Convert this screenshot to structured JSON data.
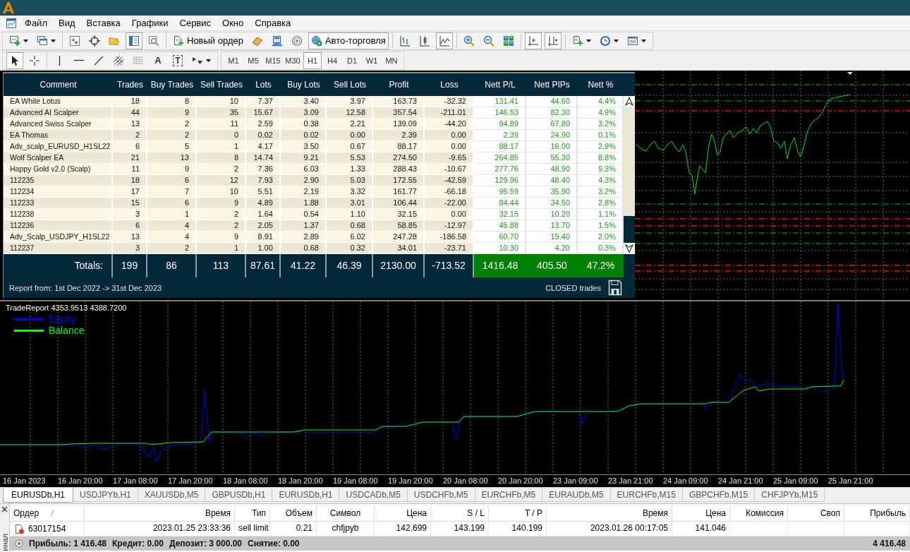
{
  "menu": [
    "Файл",
    "Вид",
    "Вставка",
    "Графики",
    "Сервис",
    "Окно",
    "Справка"
  ],
  "toolbar": [
    [
      {
        "kind": "newchart",
        "dropdown": true,
        "pressed": false
      },
      {
        "kind": "profiles",
        "dropdown": true,
        "pressed": false
      }
    ],
    [
      {
        "kind": "marketwatch",
        "dropdown": false,
        "pressed": false
      },
      {
        "kind": "navigator",
        "dropdown": false,
        "pressed": false
      },
      {
        "kind": "favorites",
        "dropdown": false,
        "pressed": false
      },
      {
        "kind": "datawindow",
        "dropdown": false,
        "pressed": true
      },
      {
        "kind": "tester",
        "dropdown": false,
        "pressed": false
      }
    ],
    [
      {
        "kind": "order",
        "label": "Новый ордер",
        "dropdown": false,
        "pressed": false
      },
      {
        "kind": "editor",
        "dropdown": false,
        "pressed": false
      },
      {
        "kind": "terminal",
        "dropdown": false,
        "pressed": false
      },
      {
        "kind": "signals",
        "dropdown": false,
        "pressed": false
      },
      {
        "kind": "autotrade",
        "label": "Авто-торговля",
        "dropdown": false,
        "pressed": true
      }
    ],
    [
      {
        "kind": "bars",
        "dropdown": false,
        "pressed": false
      },
      {
        "kind": "candles",
        "dropdown": false,
        "pressed": false
      },
      {
        "kind": "linechart",
        "dropdown": false,
        "pressed": true
      }
    ],
    [
      {
        "kind": "zoomin",
        "dropdown": false,
        "pressed": false
      },
      {
        "kind": "zoomout",
        "dropdown": false,
        "pressed": false
      },
      {
        "kind": "tile",
        "dropdown": false,
        "pressed": false
      }
    ],
    [
      {
        "kind": "autoscroll",
        "dropdown": false,
        "pressed": true
      },
      {
        "kind": "shift",
        "dropdown": false,
        "pressed": true
      }
    ],
    [
      {
        "kind": "indicators",
        "dropdown": true,
        "pressed": false
      },
      {
        "kind": "periods",
        "dropdown": true,
        "pressed": false
      },
      {
        "kind": "templates",
        "dropdown": true,
        "pressed": false
      }
    ]
  ],
  "tools": [
    [
      {
        "kind": "cursor",
        "dropdown": false,
        "pressed": true
      },
      {
        "kind": "crosshair",
        "dropdown": false,
        "pressed": false
      }
    ],
    [
      {
        "kind": "vline",
        "dropdown": false,
        "pressed": false
      },
      {
        "kind": "hline",
        "dropdown": false,
        "pressed": false
      },
      {
        "kind": "trendline",
        "dropdown": false,
        "pressed": false
      },
      {
        "kind": "fibochannel",
        "dropdown": false,
        "pressed": false
      },
      {
        "kind": "fibolines",
        "dropdown": false,
        "pressed": false
      },
      {
        "kind": "text",
        "glyph": "A",
        "dropdown": false,
        "pressed": false
      },
      {
        "kind": "label",
        "glyph": "T",
        "dropdown": false,
        "pressed": false
      },
      {
        "kind": "arrows",
        "dropdown": true,
        "pressed": false
      }
    ]
  ],
  "timeframes": [
    {
      "label": "M1",
      "selected": false
    },
    {
      "label": "M5",
      "selected": false
    },
    {
      "label": "M15",
      "selected": false
    },
    {
      "label": "M30",
      "selected": false
    },
    {
      "label": "H1",
      "selected": true
    },
    {
      "label": "H4",
      "selected": false
    },
    {
      "label": "D1",
      "selected": false
    },
    {
      "label": "W1",
      "selected": false
    },
    {
      "label": "MN",
      "selected": false
    }
  ],
  "report": {
    "columns": [
      {
        "label": "Comment",
        "kind": "name"
      },
      {
        "label": "Trades",
        "kind": "value"
      },
      {
        "label": "Buy Trades",
        "kind": "value"
      },
      {
        "label": "Sell Trades",
        "kind": "value"
      },
      {
        "label": "Lots",
        "kind": "value"
      },
      {
        "label": "Buy Lots",
        "kind": "value"
      },
      {
        "label": "Sell Lots",
        "kind": "value"
      },
      {
        "label": "Profit",
        "kind": "value"
      },
      {
        "label": "Loss",
        "kind": "value"
      },
      {
        "label": "Nett P/L",
        "kind": "net"
      },
      {
        "label": "Nett PIPs",
        "kind": "net"
      },
      {
        "label": "Nett %",
        "kind": "net"
      }
    ],
    "rows": [
      {
        "cells": [
          "EA White Lotus",
          "18",
          "8",
          "10",
          "7.37",
          "3.40",
          "3.97",
          "163.73",
          "-32.32",
          "131.41",
          "44.60",
          "4.4%"
        ]
      },
      {
        "cells": [
          "Advanced AI Scalper",
          "44",
          "9",
          "35",
          "15.67",
          "3.09",
          "12.58",
          "357.54",
          "-211.01",
          "146.53",
          "82.30",
          "4.9%"
        ]
      },
      {
        "cells": [
          "Advanced Swiss Scalper",
          "13",
          "2",
          "11",
          "2.59",
          "0.38",
          "2.21",
          "139.09",
          "-44.20",
          "94.89",
          "67.80",
          "3.2%"
        ]
      },
      {
        "cells": [
          "EA Thomas",
          "2",
          "2",
          "0",
          "0.02",
          "0.02",
          "0.00",
          "2.39",
          "0.00",
          "2.39",
          "24.90",
          "0.1%"
        ]
      },
      {
        "cells": [
          "Adv_scalp_EURUSD_H1SL22",
          "6",
          "5",
          "1",
          "4.17",
          "3.50",
          "0.67",
          "88.17",
          "0.00",
          "88.17",
          "16.00",
          "2.9%"
        ]
      },
      {
        "cells": [
          "Wolf Scalper EA",
          "21",
          "13",
          "8",
          "14.74",
          "9.21",
          "5.53",
          "274.50",
          "-9.65",
          "264.85",
          "55.30",
          "8.8%"
        ]
      },
      {
        "cells": [
          "Happy Gold v2.0 (Scalp)",
          "11",
          "9",
          "2",
          "7.36",
          "6.03",
          "1.33",
          "288.43",
          "-10.67",
          "277.76",
          "48.90",
          "9.3%"
        ]
      },
      {
        "cells": [
          "112235",
          "18",
          "6",
          "12",
          "7.93",
          "2.90",
          "5.03",
          "172.55",
          "-42.59",
          "129.96",
          "48.40",
          "4.3%"
        ]
      },
      {
        "cells": [
          "112234",
          "17",
          "7",
          "10",
          "5.51",
          "2.19",
          "3.32",
          "161.77",
          "-66.18",
          "95.59",
          "35.90",
          "3.2%"
        ]
      },
      {
        "cells": [
          "112233",
          "15",
          "6",
          "9",
          "4.89",
          "1.88",
          "3.01",
          "106.44",
          "-22.00",
          "84.44",
          "34.50",
          "2.8%"
        ]
      },
      {
        "cells": [
          "112238",
          "3",
          "1",
          "2",
          "1.64",
          "0.54",
          "1.10",
          "32.15",
          "0.00",
          "32.15",
          "10.20",
          "1.1%"
        ]
      },
      {
        "cells": [
          "112236",
          "6",
          "4",
          "2",
          "2.05",
          "1.37",
          "0.68",
          "58.85",
          "-12.97",
          "45.88",
          "13.70",
          "1.5%"
        ]
      },
      {
        "cells": [
          "Adv_Scalp_USDJPY_H1SL22",
          "13",
          "4",
          "9",
          "8.91",
          "2.89",
          "6.02",
          "247.28",
          "-186.58",
          "60.70",
          "15.40",
          "2.0%"
        ]
      },
      {
        "cells": [
          "112237",
          "3",
          "2",
          "1",
          "1.00",
          "0.68",
          "0.32",
          "34.01",
          "-23.71",
          "10.30",
          "4.20",
          "0.3%"
        ]
      }
    ],
    "totals": {
      "label": "Totals:",
      "cells": [
        "199",
        "86",
        "113",
        "87.61",
        "41.22",
        "46.39",
        "2130.00",
        "-713.52",
        "1416.48",
        "405.50",
        "47.2%"
      ]
    },
    "period": "Report from: 1st Dec 2022 -> 31st Dec 2023",
    "filter": "CLOSED trades"
  },
  "chart": {
    "indicator": "TradeReport 4353.9513 4388.7200",
    "legend": [
      {
        "label": "Equity",
        "color": "#0000ff"
      },
      {
        "label": "Balance",
        "color": "#00ff00"
      }
    ],
    "time_labels": [
      "16 Jan 2023",
      "16 Jan 20:00",
      "17 Jan 08:00",
      "17 Jan 20:00",
      "18 Jan 08:00",
      "18 Jan 20:00",
      "19 Jan 08:00",
      "19 Jan 20:00",
      "20 Jan 08:00",
      "20 Jan 20:00",
      "23 Jan 09:00",
      "23 Jan 21:00",
      "24 Jan 09:00",
      "24 Jan 21:00",
      "25 Jan 09:00",
      "25 Jan 21:00"
    ]
  },
  "tabs": [
    {
      "label": "EURUSDb,H1",
      "selected": true
    },
    {
      "label": "USDJPYb,H1",
      "selected": false
    },
    {
      "label": "XAUUSDb,M5",
      "selected": false
    },
    {
      "label": "GBPUSDb,H1",
      "selected": false
    },
    {
      "label": "EURUSDb,H1",
      "selected": false
    },
    {
      "label": "USDCADb,M5",
      "selected": false
    },
    {
      "label": "USDCHFb,M5",
      "selected": false
    },
    {
      "label": "EURCHFb,M5",
      "selected": false
    },
    {
      "label": "EURAUDb,M5",
      "selected": false
    },
    {
      "label": "EURCHFb,M15",
      "selected": false
    },
    {
      "label": "GBPCHFb,M15",
      "selected": false
    },
    {
      "label": "CHFJPYb,M15",
      "selected": false
    }
  ],
  "terminal": {
    "title": "инал",
    "columns": [
      {
        "label": "Ордер",
        "sorted": true
      },
      {
        "label": "Время",
        "sorted": false
      },
      {
        "label": "Тип",
        "sorted": false
      },
      {
        "label": "Объем",
        "sorted": false
      },
      {
        "label": "Символ",
        "sorted": false
      },
      {
        "label": "Цена",
        "sorted": false
      },
      {
        "label": "S / L",
        "sorted": false
      },
      {
        "label": "T / P",
        "sorted": false
      },
      {
        "label": "Время",
        "sorted": false
      },
      {
        "label": "Цена",
        "sorted": false
      },
      {
        "label": "Комиссия",
        "sorted": false
      },
      {
        "label": "Своп",
        "sorted": false
      },
      {
        "label": "Прибыль",
        "sorted": false
      }
    ],
    "rows": [
      {
        "cells": [
          "63017154",
          "2023.01.25 23:33:36",
          "sell limit",
          "0.21",
          "chfjpyb",
          "142.699",
          "143.199",
          "140.199",
          "2023.01.26 00:17:05",
          "141.046"
        ]
      }
    ],
    "summary": [
      "Прибыль: 1 416.48",
      "Кредит: 0.00",
      "Депозит: 3 000.00",
      "Снятие: 0.00"
    ],
    "total": "4 416.48"
  }
}
